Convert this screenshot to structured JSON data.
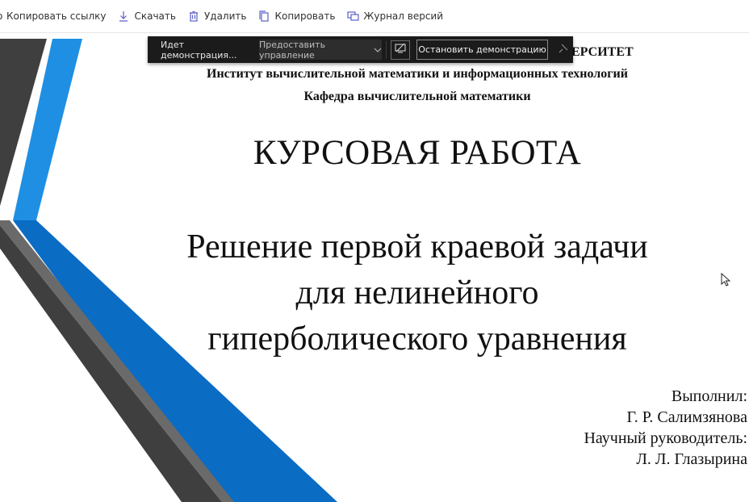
{
  "toolbar": {
    "items": [
      {
        "label": "Копировать ссылку",
        "icon": "link-icon"
      },
      {
        "label": "Скачать",
        "icon": "download-icon"
      },
      {
        "label": "Удалить",
        "icon": "delete-icon"
      },
      {
        "label": "Копировать",
        "icon": "copy-icon"
      },
      {
        "label": "Журнал версий",
        "icon": "version-history-icon"
      }
    ]
  },
  "share_bar": {
    "status": "Идет демонстрация...",
    "give_control": "Предоставить управление",
    "stop": "Остановить демонстрацию"
  },
  "slide": {
    "university": "ЕРСИТЕТ",
    "institute": "Институт вычислительной математики и информационных технологий",
    "department": "Кафедра вычислительной математики",
    "doc_type": "КУРСОВАЯ РАБОТА",
    "topic_lines": [
      "Решение первой краевой задачи",
      "для нелинейного",
      "гиперболического уравнения"
    ],
    "credits": [
      "Выполнил:",
      "Г. Р. Салимзянова",
      "Научный руководитель:",
      "Л. Л. Глазырина"
    ]
  },
  "colors": {
    "accent_blue": "#1f8fe3",
    "dark_blue": "#0b6cc4",
    "gray_stripe": "#3f3f3f",
    "share_bar_bg": "#1b1b1b"
  }
}
